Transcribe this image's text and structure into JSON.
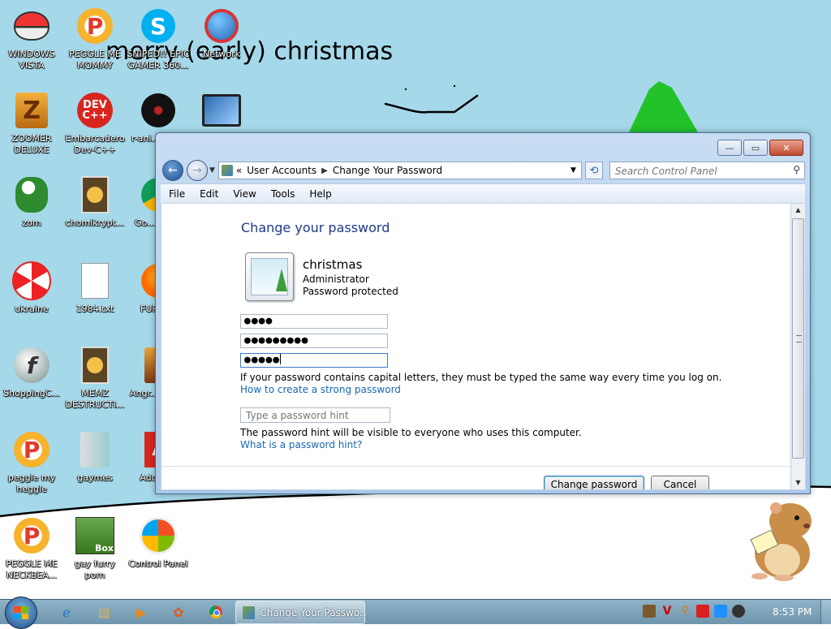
{
  "desktop": {
    "scribble_title": "merry (early) christmas",
    "icons": [
      {
        "label": "WINDOWS VISTA",
        "name": "desktop-icon-windows-vista",
        "icon": "pokeball-icon"
      },
      {
        "label": "PEGGLE ME MOMMY",
        "name": "desktop-icon-peggle-me-mommy",
        "icon": "peggle-p-icon"
      },
      {
        "label": "SNIPED!! EPIC GAMER 360...",
        "name": "desktop-icon-sniped",
        "icon": "skype-icon"
      },
      {
        "label": "Network",
        "name": "desktop-icon-network",
        "icon": "network-globe-icon"
      },
      {
        "label": "ZOOMER DELUXE",
        "name": "desktop-icon-zoomer-deluxe",
        "icon": "zuma-icon"
      },
      {
        "label": "Embarcadero Dev-C++",
        "name": "desktop-icon-dev-cpp",
        "icon": "devcpp-icon"
      },
      {
        "label": "r-ani... par...",
        "name": "desktop-icon-r-ani",
        "icon": "dark-disc-icon"
      },
      {
        "label": "",
        "name": "desktop-icon-monitor",
        "icon": "monitor-icon"
      },
      {
        "label": "zom",
        "name": "desktop-icon-zom",
        "icon": "plant-icon"
      },
      {
        "label": "chomikrypt...",
        "name": "desktop-icon-chomikrypt",
        "icon": "clock-app-icon"
      },
      {
        "label": "Go... Chr...",
        "name": "desktop-icon-chrome",
        "icon": "chrome-icon"
      },
      {
        "label": "ukraine",
        "name": "desktop-icon-ukraine",
        "icon": "radiation-icon"
      },
      {
        "label": "1984.txt",
        "name": "desktop-icon-1984-txt",
        "icon": "text-file-icon"
      },
      {
        "label": "FURRY...",
        "name": "desktop-icon-furry",
        "icon": "firefox-icon"
      },
      {
        "label": "ShoppingC...",
        "name": "desktop-icon-shopping",
        "icon": "flash-icon"
      },
      {
        "label": "MEMZ DESTRUCTI...",
        "name": "desktop-icon-memz",
        "icon": "clock-app-icon"
      },
      {
        "label": "Angr... Sea...",
        "name": "desktop-icon-angry-birds",
        "icon": "game-icon"
      },
      {
        "label": "peggle my heggle",
        "name": "desktop-icon-peggle-my-heggle",
        "icon": "peggle-p-icon"
      },
      {
        "label": "gaymes",
        "name": "desktop-icon-gaymes",
        "icon": "media-folder-icon"
      },
      {
        "label": "Adobe...",
        "name": "desktop-icon-adobe",
        "icon": "acrobat-icon"
      },
      {
        "label": "PEGGLE ME NECKBEA...",
        "name": "desktop-icon-peggle-me-neckbea",
        "icon": "peggle-p-icon"
      },
      {
        "label": "gay furry porn",
        "name": "desktop-icon-box",
        "icon": "beaver-box-icon"
      },
      {
        "label": "Control Panel",
        "name": "desktop-icon-control-panel",
        "icon": "windows-orb-icon"
      }
    ]
  },
  "window": {
    "caption_buttons": {
      "minimize": "—",
      "maximize": "▭",
      "close": "✕"
    },
    "breadcrumb": [
      "User Accounts",
      "Change Your Password"
    ],
    "breadcrumb_prefix": "«",
    "search_placeholder": "Search Control Panel",
    "menu": [
      "File",
      "Edit",
      "View",
      "Tools",
      "Help"
    ],
    "page_title": "Change your password",
    "user": {
      "name": "christmas",
      "role": "Administrator",
      "status": "Password protected"
    },
    "fields": {
      "current_password": "●●●●",
      "new_password": "●●●●●●●●●",
      "confirm_password": "●●●●●",
      "hint_placeholder": "Type a password hint"
    },
    "caps_note": "If your password contains capital letters, they must be typed the same way every time you log on.",
    "strong_link": "How to create a strong password",
    "hint_note": "The password hint will be visible to everyone who uses this computer.",
    "hint_link": "What is a password hint?",
    "buttons": {
      "change": "Change password",
      "cancel": "Cancel"
    }
  },
  "taskbar": {
    "active_task": "Change Your Passwo...",
    "clock": "8:53 PM",
    "pinned": [
      "internet-explorer-icon",
      "file-explorer-icon",
      "media-player-icon",
      "app-icon",
      "chrome-icon"
    ],
    "tray": [
      "beaver-tray-icon",
      "v-tray-icon",
      "search-tray-icon",
      "flag-tray-icon",
      "monitor-tray-icon",
      "volume-tray-icon"
    ]
  }
}
